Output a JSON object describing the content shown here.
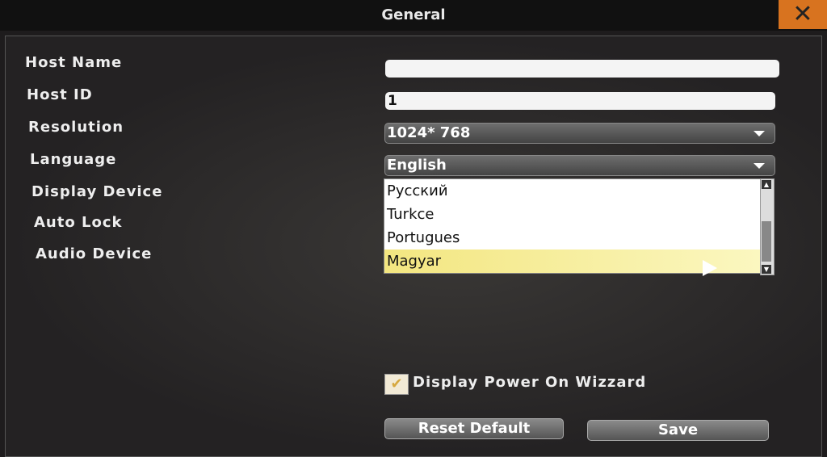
{
  "window": {
    "title": "General",
    "close_icon": "close-x-icon",
    "close_color": "#d8731f"
  },
  "labels": {
    "host_name": "Host Name",
    "host_id": "Host ID",
    "resolution": "Resolution",
    "language": "Language",
    "display_device": "Display Device",
    "auto_lock": "Auto Lock",
    "audio_device": "Audio Device"
  },
  "fields": {
    "host_name": "",
    "host_id": "1",
    "resolution": "1024* 768",
    "language": "English"
  },
  "language_options": [
    {
      "label": "Русский"
    },
    {
      "label": "Turkce"
    },
    {
      "label": "Portugues"
    },
    {
      "label": "Magyar",
      "highlighted": true
    }
  ],
  "wizard": {
    "label": "Display Power On Wizzard",
    "checked": true
  },
  "buttons": {
    "reset": "Reset Default",
    "save": "Save"
  }
}
